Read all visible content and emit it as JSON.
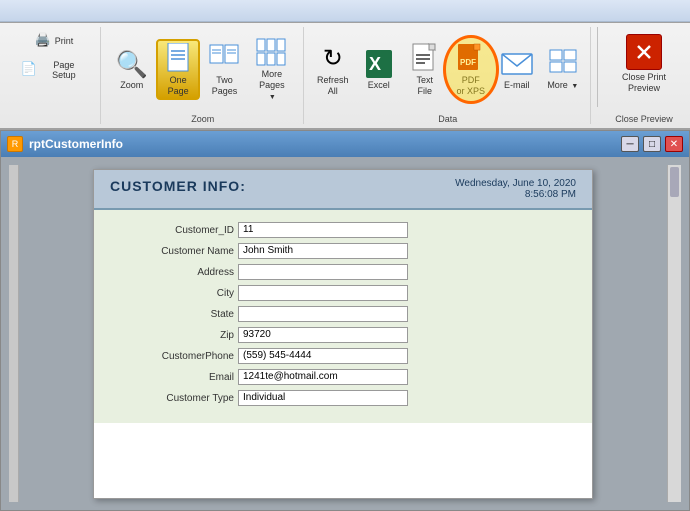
{
  "ribbon": {
    "groups": [
      {
        "name": "page-setup",
        "label": "",
        "buttons": [
          {
            "id": "print",
            "label": "Print",
            "icon": "🖨️",
            "active": false
          },
          {
            "id": "page-setup",
            "label": "Page\nSetup",
            "icon": "📄",
            "active": false
          }
        ]
      },
      {
        "name": "zoom",
        "label": "Zoom",
        "buttons": [
          {
            "id": "zoom",
            "label": "Zoom",
            "icon": "🔍",
            "active": false
          },
          {
            "id": "one-page",
            "label": "One\nPage",
            "icon": "📋",
            "active": true
          },
          {
            "id": "two-pages",
            "label": "Two\nPages",
            "icon": "📑",
            "active": false
          },
          {
            "id": "more-pages",
            "label": "More\nPages",
            "icon": "📄",
            "active": false,
            "dropdown": true
          }
        ]
      },
      {
        "name": "data",
        "label": "Data",
        "buttons": [
          {
            "id": "refresh-all",
            "label": "Refresh\nAll",
            "icon": "🔄",
            "active": false
          },
          {
            "id": "excel",
            "label": "Excel",
            "icon": "📊",
            "active": false
          },
          {
            "id": "text-file",
            "label": "Text\nFile",
            "icon": "📝",
            "active": false
          },
          {
            "id": "pdf-xps",
            "label": "PDF\nor XPS",
            "icon": "📕",
            "active": true,
            "highlighted": true
          },
          {
            "id": "email",
            "label": "E-mail",
            "icon": "✉️",
            "active": false
          },
          {
            "id": "more",
            "label": "More",
            "icon": "📦",
            "active": false,
            "dropdown": true
          }
        ]
      },
      {
        "name": "close-preview",
        "label": "Close Preview",
        "buttons": [
          {
            "id": "close-print-preview",
            "label": "Close Print\nPreview",
            "icon": "✕",
            "active": false
          }
        ]
      }
    ]
  },
  "document": {
    "title": "rptCustomerInfo",
    "report": {
      "heading": "CUSTOMER INFO:",
      "date": "Wednesday, June 10, 2020",
      "time": "8:56:08 PM",
      "fields": [
        {
          "label": "Customer_ID",
          "value": "11"
        },
        {
          "label": "Customer Name",
          "value": "John Smith"
        },
        {
          "label": "Address",
          "value": ""
        },
        {
          "label": "City",
          "value": ""
        },
        {
          "label": "State",
          "value": ""
        },
        {
          "label": "Zip",
          "value": "93720"
        },
        {
          "label": "CustomerPhone",
          "value": "(559) 545-4444"
        },
        {
          "label": "Email",
          "value": "1241te@hotmail.com"
        },
        {
          "label": "Customer Type",
          "value": "Individual"
        }
      ]
    }
  },
  "icons": {
    "print": "🖨️",
    "page-setup": "📄",
    "zoom": "🔍",
    "one-page": "▣",
    "two-pages": "▤",
    "more-pages": "▥",
    "refresh": "↻",
    "excel": "📊",
    "text-file": "📃",
    "pdf": "📕",
    "email": "✉",
    "more": "⊞",
    "close": "✕",
    "minimize": "─",
    "restore": "□"
  }
}
